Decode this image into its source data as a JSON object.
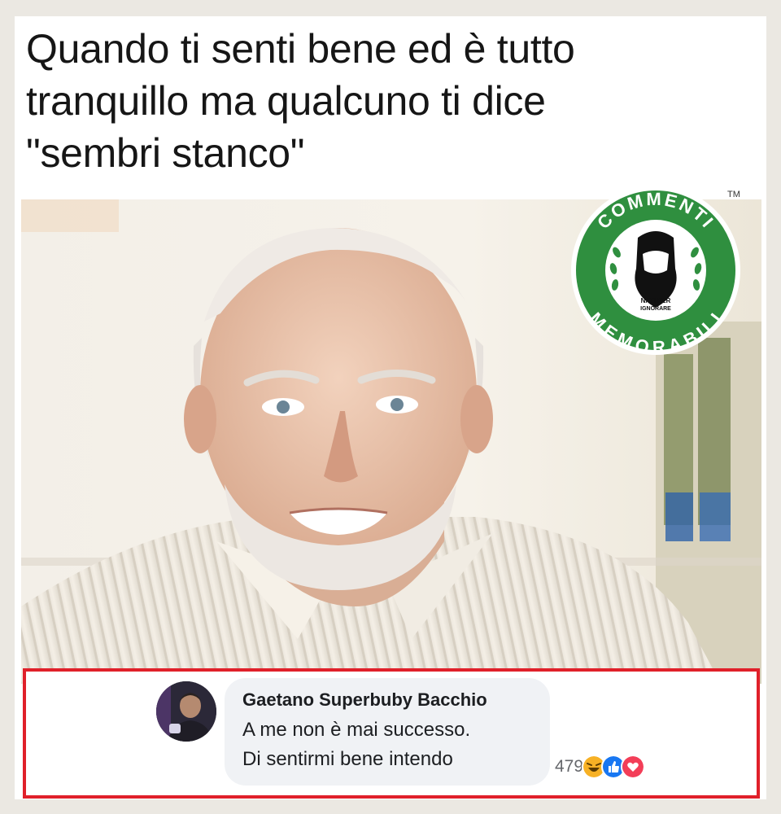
{
  "caption": "Quando ti senti bene ed è tutto\ntranquillo ma qualcuno ti dice\n\"sembri stanco\"",
  "badge": {
    "top_text": "COMMENTI",
    "bottom_text": "MEMORABILI",
    "small_text_line1": "NATI PER",
    "small_text_line2": "IGNORARE",
    "trademark": "TM",
    "color": "#2f8f3f"
  },
  "comment": {
    "author": "Gaetano Superbuby Bacchio",
    "text": "A me non è mai successo.\nDi sentirmi bene intendo",
    "reaction_count": "479",
    "reactions": [
      "laugh-icon",
      "like-icon",
      "love-icon"
    ],
    "highlight_color": "#e0202a"
  }
}
